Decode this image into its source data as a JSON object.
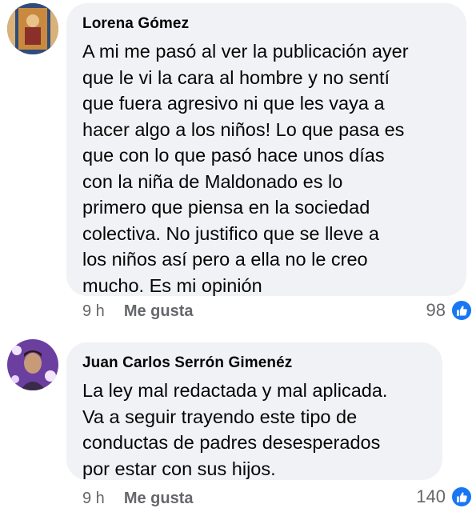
{
  "comments": [
    {
      "author": "Lorena Gómez",
      "lines": [
        "A mi me pasó al ver la publicación ayer",
        "que le vi la cara al hombre y no sentí",
        "que fuera agresivo ni que les vaya a",
        "hacer algo a los niños! Lo que pasa es",
        "que con lo que pasó hace unos días",
        "con la niña de Maldonado es lo",
        "primero que piensa en la sociedad",
        "colectiva. No justifico que se lleve a",
        "los niños así pero a ella no le creo",
        "mucho. Es mi opinión"
      ],
      "time": "9 h",
      "like_label": "Me gusta",
      "reaction_count": "98",
      "reaction_icon": "like-icon"
    },
    {
      "author": "Juan Carlos Serrón Gimenéz",
      "lines": [
        "La ley mal redactada y mal aplicada.",
        "Va a seguir trayendo este tipo de",
        "conductas de padres desesperados",
        "por estar con sus hijos."
      ],
      "time": "9 h",
      "like_label": "Me gusta",
      "reaction_count": "140",
      "reaction_icon": "like-icon"
    }
  ],
  "colors": {
    "bubble": "#f0f2f5",
    "meta_text": "#65676b",
    "like_blue": "#1877f2"
  }
}
